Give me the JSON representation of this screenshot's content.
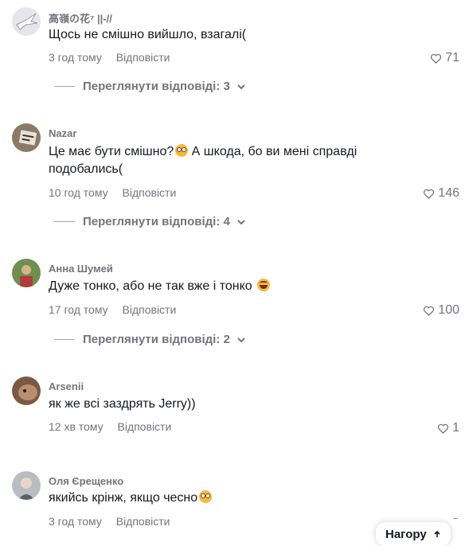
{
  "comments": [
    {
      "author": "高嶺の花⁷ ||-//",
      "text": "Щось не смішно вийшло, взагалі(",
      "time": "3 год тому",
      "reply_label": "Відповісти",
      "likes": "71",
      "view_replies": "Переглянути відповіді: 3"
    },
    {
      "author": "Nazar",
      "text": "Це має бути смішно?",
      "text_tail": " А шкода, бо ви мені справді подобались(",
      "time": "10 год тому",
      "reply_label": "Відповісти",
      "likes": "146",
      "view_replies": "Переглянути відповіді: 4"
    },
    {
      "author": "Анна Шумей",
      "text": "Дуже тонко, або не так вже і тонко ",
      "time": "17 год тому",
      "reply_label": "Відповісти",
      "likes": "100",
      "view_replies": "Переглянути відповіді: 2"
    },
    {
      "author": "Arsenii",
      "text": "як же всі заздрять Jerry))",
      "time": "12 хв тому",
      "reply_label": "Відповісти",
      "likes": "1"
    },
    {
      "author": "Оля Єрещенко",
      "text": "якийсь крінж, якщо чесно",
      "time": "3 год тому",
      "reply_label": "Відповісти"
    }
  ],
  "back_to_top": "Нагору"
}
